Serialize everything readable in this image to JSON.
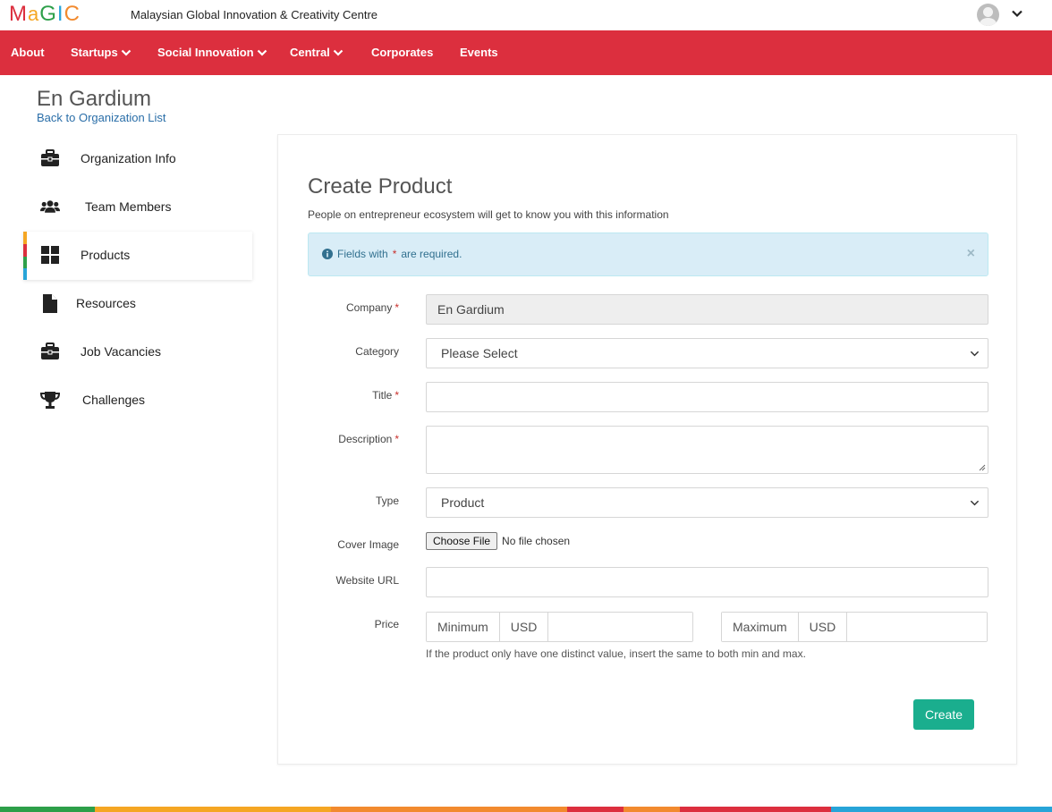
{
  "brand": {
    "logo_letters": [
      "M",
      "a",
      "G",
      "I",
      "C"
    ],
    "logo_colors": [
      "#dc2f3e",
      "#f5a623",
      "#2d9f49",
      "#27a4d8",
      "#f28a2e"
    ],
    "site_title": "Malaysian Global Innovation & Creativity Centre"
  },
  "nav": {
    "items": [
      {
        "label": "About"
      },
      {
        "label": "Startups"
      },
      {
        "label": "Social Innovation"
      },
      {
        "label": "Central"
      },
      {
        "label": "Corporates"
      },
      {
        "label": "Events"
      }
    ],
    "background": "#dc2f3e"
  },
  "header": {
    "org_name": "En Gardium",
    "back_link": "Back to Organization List"
  },
  "sidebar": {
    "items": [
      {
        "label": "Organization Info",
        "icon": "briefcase-icon"
      },
      {
        "label": "Team Members",
        "icon": "users-icon"
      },
      {
        "label": "Products",
        "icon": "grid-icon",
        "active": true
      },
      {
        "label": "Resources",
        "icon": "file-icon"
      },
      {
        "label": "Job Vacancies",
        "icon": "briefcase-icon"
      },
      {
        "label": "Challenges",
        "icon": "trophy-icon"
      }
    ],
    "active_bar_colors": [
      "#f5a623",
      "#dc2f3e",
      "#2d9f49",
      "#27a4d8"
    ]
  },
  "form": {
    "title": "Create Product",
    "subtitle": "People on entrepreneur ecosystem will get to know you with this information",
    "alert": {
      "prefix": "Fields with",
      "star": "*",
      "suffix": "are required.",
      "close": "×"
    },
    "labels": {
      "company": "Company",
      "category": "Category",
      "title": "Title",
      "description": "Description",
      "type": "Type",
      "cover_image": "Cover Image",
      "website_url": "Website URL",
      "price": "Price"
    },
    "required_star": "*",
    "company_value": "En Gardium",
    "category_value": "Please Select",
    "type_value": "Product",
    "file_button": "Choose File",
    "file_status": "No file chosen",
    "price": {
      "min_label": "Minimum",
      "max_label": "Maximum",
      "currency": "USD",
      "help": "If the product only have one distinct value, insert the same to both min and max."
    },
    "submit_label": "Create",
    "submit_color": "#1aae8e"
  },
  "footer_stripe_colors": [
    "#2d9f49",
    "#f5a623",
    "#f28a2e",
    "#dc2f3e",
    "#f28a2e",
    "#dc2f3e",
    "#27a4d8"
  ]
}
